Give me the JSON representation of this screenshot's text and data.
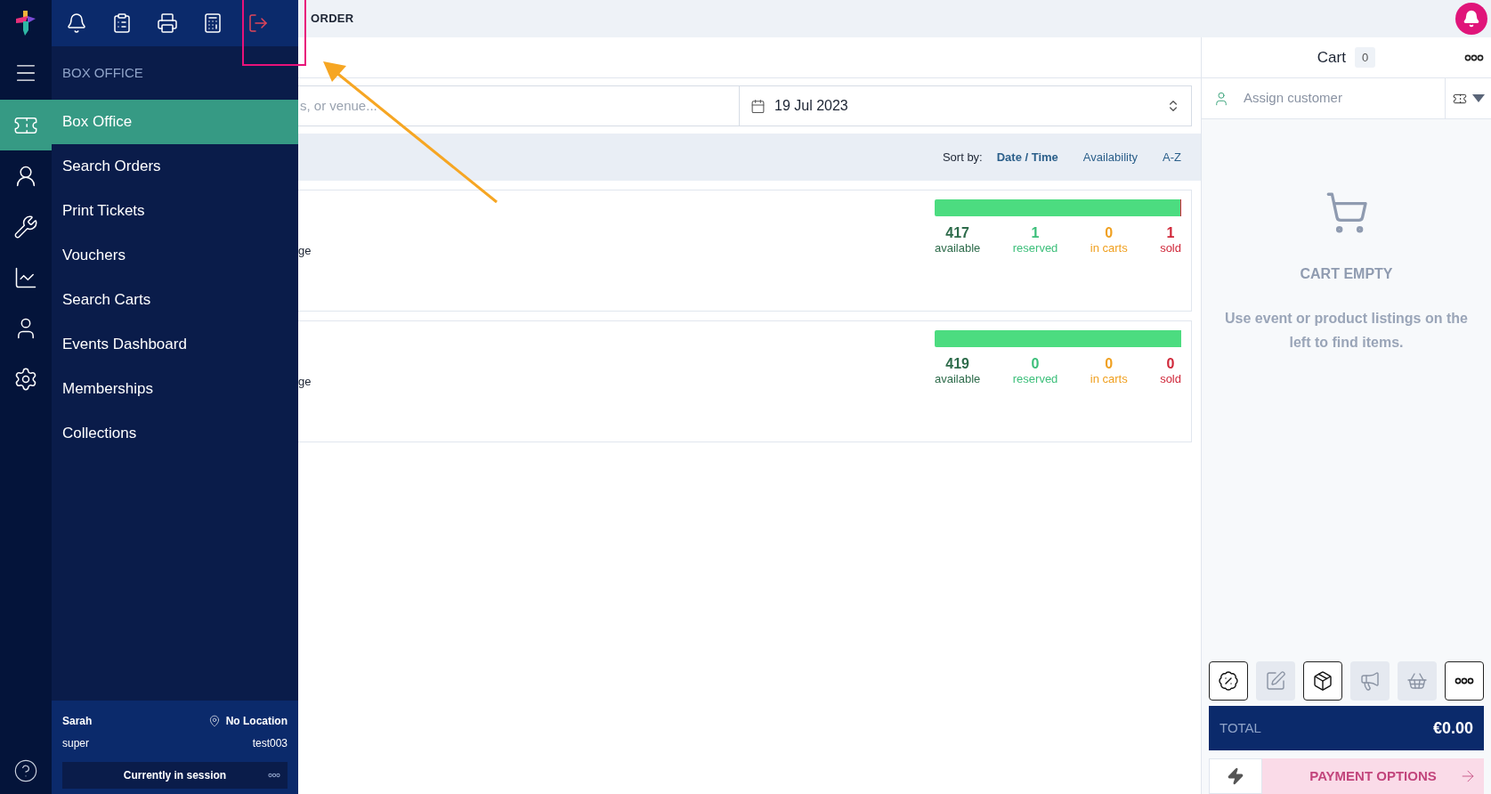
{
  "header": {
    "title": "ORDER"
  },
  "rail": {
    "items": [
      {
        "kind": "ticket",
        "selected": true
      },
      {
        "kind": "customer",
        "selected": false
      },
      {
        "kind": "tools",
        "selected": false
      },
      {
        "kind": "reports",
        "selected": false
      },
      {
        "kind": "account",
        "selected": false
      },
      {
        "kind": "settings",
        "selected": false
      }
    ]
  },
  "sidebar": {
    "section": "BOX OFFICE",
    "items": [
      {
        "label": "Box Office",
        "selected": true
      },
      {
        "label": "Search Orders",
        "selected": false
      },
      {
        "label": "Print Tickets",
        "selected": false
      },
      {
        "label": "Vouchers",
        "selected": false
      },
      {
        "label": "Search Carts",
        "selected": false
      },
      {
        "label": "Events Dashboard",
        "selected": false
      },
      {
        "label": "Memberships",
        "selected": false
      },
      {
        "label": "Collections",
        "selected": false
      }
    ]
  },
  "user": {
    "name": "Sarah",
    "location": "No Location",
    "role": "super",
    "terminal": "test003",
    "session_button": "Currently in session"
  },
  "search": {
    "placeholder": "s, or venue..."
  },
  "date_field": {
    "value": "19 Jul 2023"
  },
  "sort": {
    "label": "Sort by:",
    "options": [
      {
        "label": "Date / Time",
        "selected": true
      },
      {
        "label": "Availability",
        "selected": false
      },
      {
        "label": "A-Z",
        "selected": false
      }
    ]
  },
  "events": [
    {
      "fragment": "ge",
      "level": 0.995,
      "stats": [
        {
          "value": "417",
          "label": "available",
          "color": "#2d6b4a"
        },
        {
          "value": "1",
          "label": "reserved",
          "color": "#3cbf7a"
        },
        {
          "value": "0",
          "label": "in carts",
          "color": "#f0a020"
        },
        {
          "value": "1",
          "label": "sold",
          "color": "#d0283a"
        }
      ]
    },
    {
      "fragment": "ge",
      "level": 1,
      "stats": [
        {
          "value": "419",
          "label": "available",
          "color": "#2d6b4a"
        },
        {
          "value": "0",
          "label": "reserved",
          "color": "#3cbf7a"
        },
        {
          "value": "0",
          "label": "in carts",
          "color": "#f0a020"
        },
        {
          "value": "0",
          "label": "sold",
          "color": "#d0283a"
        }
      ]
    }
  ],
  "cart": {
    "title": "Cart",
    "count": "0",
    "customer_placeholder": "Assign customer",
    "empty_title": "CART EMPTY",
    "empty_text": "Use event or product listings on the left to find items.",
    "tools": [
      {
        "kind": "discount",
        "disabled": false
      },
      {
        "kind": "notes",
        "disabled": true
      },
      {
        "kind": "delivery",
        "disabled": false
      },
      {
        "kind": "promo",
        "disabled": true
      },
      {
        "kind": "basket",
        "disabled": true
      },
      {
        "kind": "more",
        "disabled": false
      }
    ],
    "total_label": "TOTAL",
    "total": "€0.00",
    "payment_button": "PAYMENT OPTIONS",
    "payment_disabled": true
  }
}
